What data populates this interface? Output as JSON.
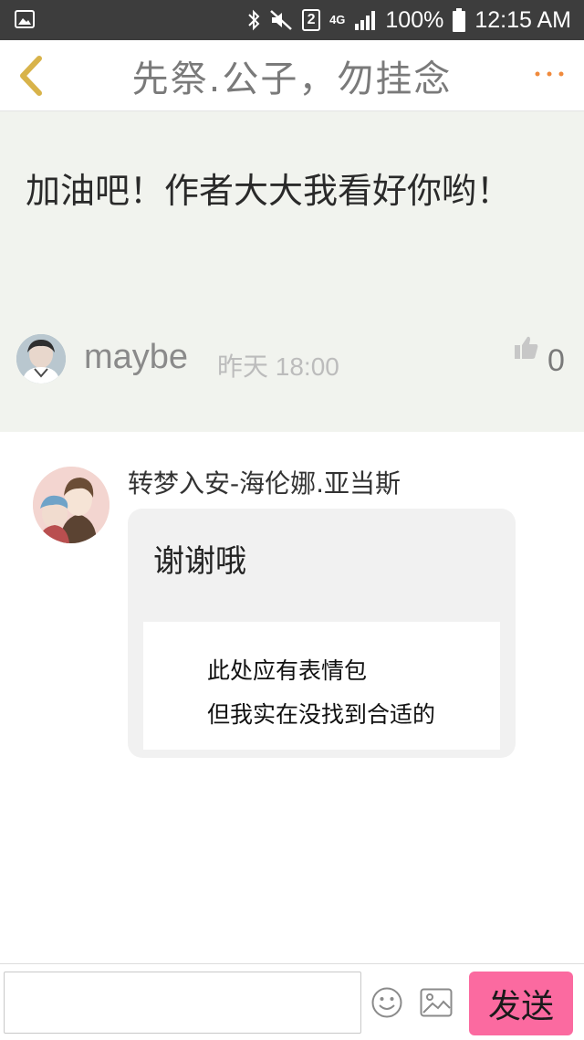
{
  "status_bar": {
    "network": "4G",
    "sim": "2",
    "battery": "100%",
    "time": "12:15 AM"
  },
  "nav": {
    "title": "先祭.公子，勿挂念",
    "more_label": "···"
  },
  "comment": {
    "text": "加油吧！作者大大我看好你哟！",
    "author": "maybe",
    "time": "昨天 18:00",
    "likes": "0"
  },
  "reply": {
    "author": "转梦入安-海伦娜.亚当斯",
    "text": "谢谢哦",
    "sticker_line1": "此处应有表情包",
    "sticker_line2": "但我实在没找到合适的"
  },
  "input_bar": {
    "placeholder": "",
    "send_label": "发送"
  },
  "colors": {
    "accent_orange": "#f08a3c",
    "send_pink": "#fb6aa0",
    "comment_bg": "#f1f3ee"
  }
}
